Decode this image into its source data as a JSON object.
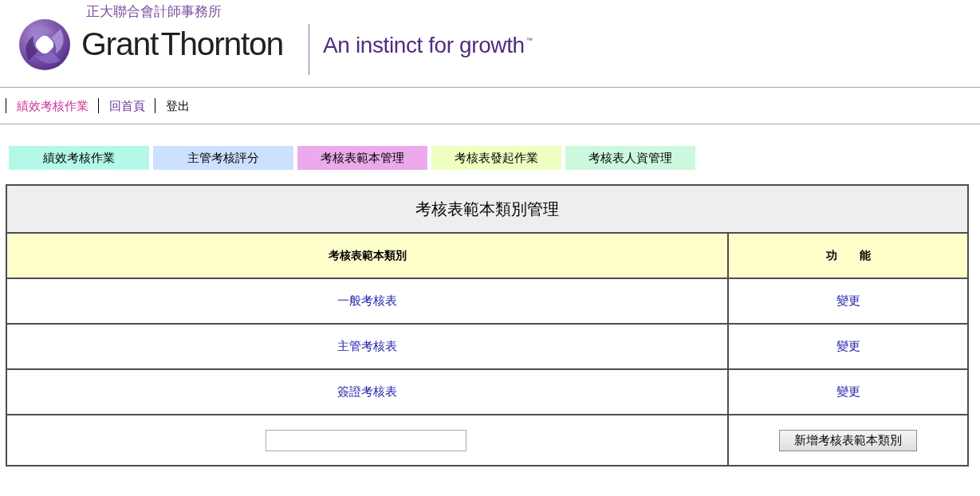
{
  "header": {
    "firm_name": "正大聯合會計師事務所",
    "wordmark": "Grant Thornton",
    "tagline": "An instinct for growth",
    "trademark": "™"
  },
  "nav": [
    {
      "label": "績效考核作業",
      "color": "#cc3399"
    },
    {
      "label": "回首頁",
      "color": "#663399"
    },
    {
      "label": "登出",
      "color": "#000000"
    }
  ],
  "tabs": [
    {
      "label": "績效考核作業",
      "color": "#b4f8e8"
    },
    {
      "label": "主管考核評分",
      "color": "#cce0ff"
    },
    {
      "label": "考核表範本管理",
      "color": "#ecaaec"
    },
    {
      "label": "考核表發起作業",
      "color": "#eeffc0"
    },
    {
      "label": "考核表人資管理",
      "color": "#ccf8de"
    }
  ],
  "table": {
    "title": "考核表範本類別管理",
    "columns": [
      "考核表範本類別",
      "功　　能"
    ],
    "rows": [
      {
        "category": "一般考核表",
        "action": "變更"
      },
      {
        "category": "主管考核表",
        "action": "變更"
      },
      {
        "category": "簽證考核表",
        "action": "變更"
      }
    ],
    "new_row": {
      "button": "新增考核表範本類別"
    }
  }
}
